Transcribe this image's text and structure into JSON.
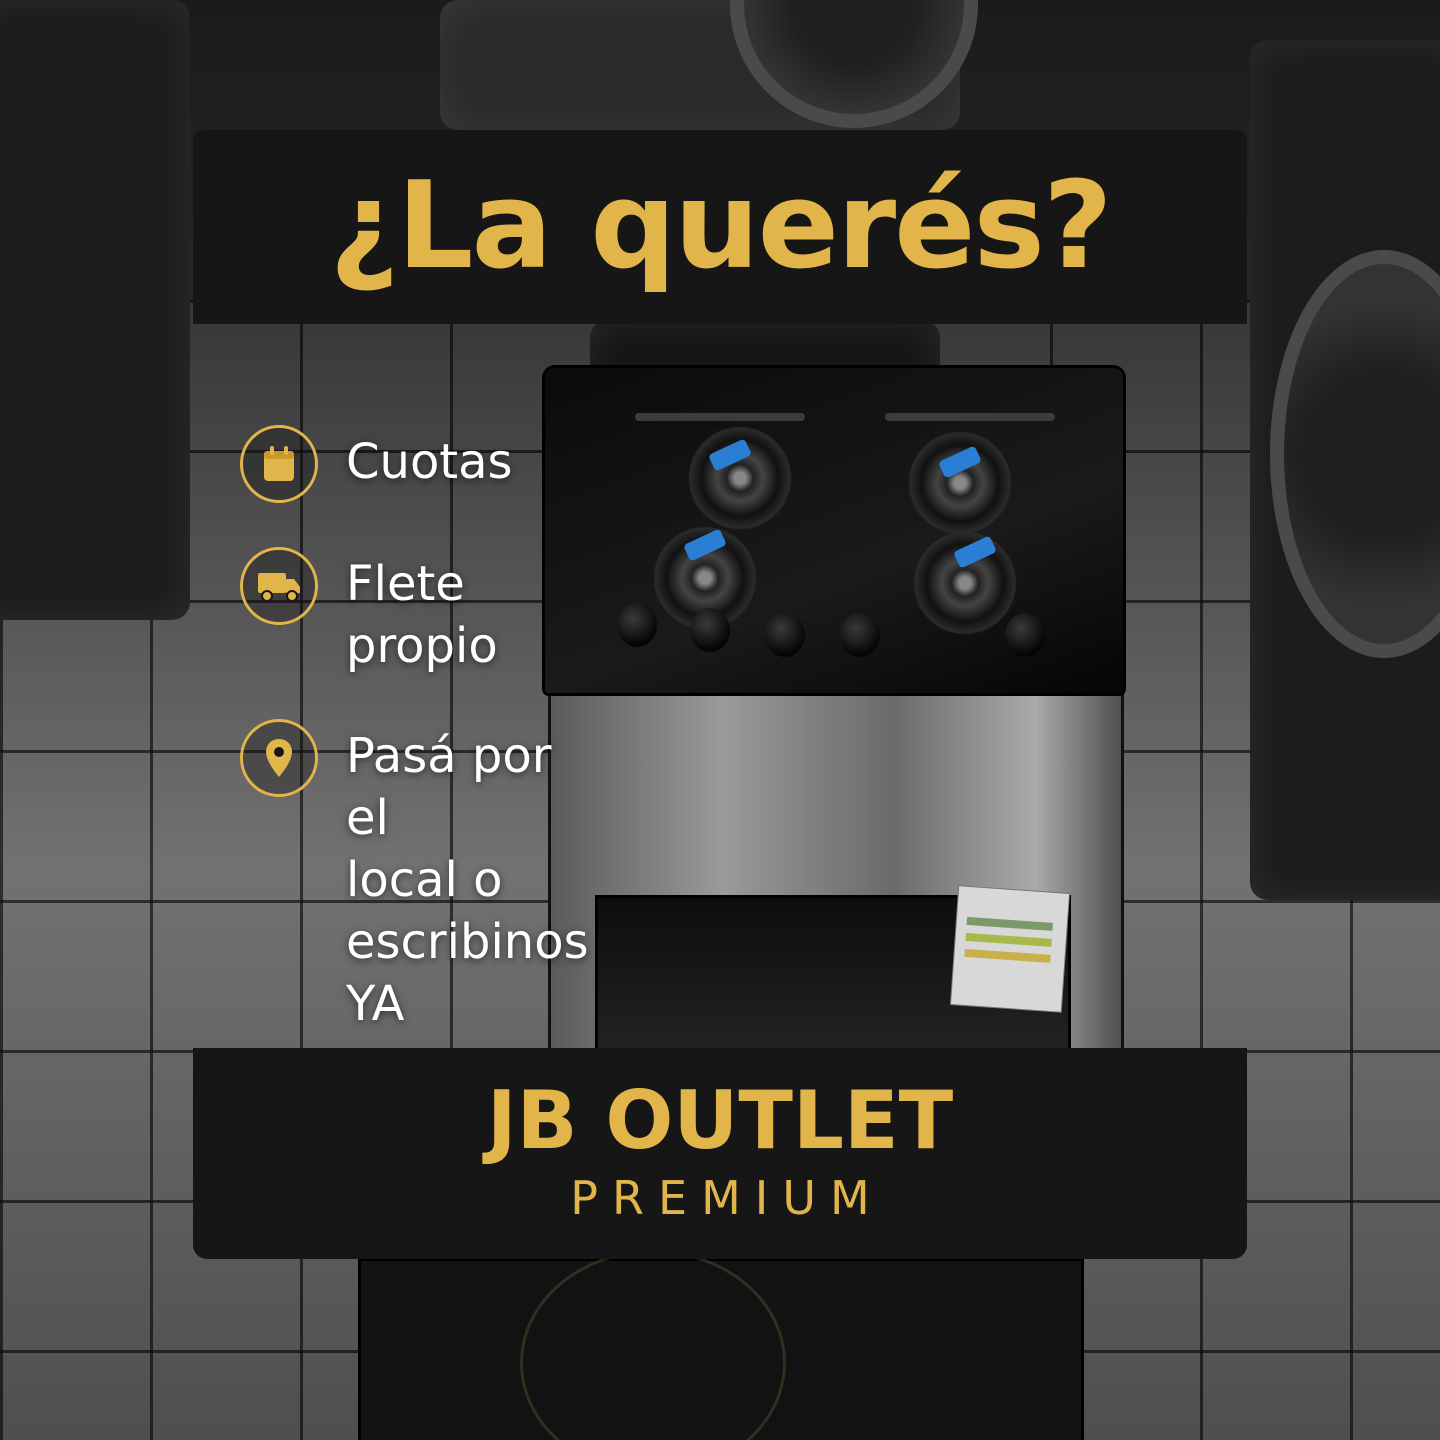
{
  "headline": "¿La querés?",
  "features": [
    {
      "icon": "calendar-icon",
      "lines": [
        "Cuotas"
      ]
    },
    {
      "icon": "delivery-truck-icon",
      "lines": [
        "Flete",
        "propio"
      ]
    },
    {
      "icon": "location-pin-icon",
      "lines": [
        "Pasá por el",
        "local o",
        "escribinos YA"
      ]
    }
  ],
  "brand": {
    "name": "JB OUTLET",
    "tagline": "PREMIUM"
  },
  "colors": {
    "accent": "#e2b54a",
    "panel": "#161616",
    "text": "#ffffff"
  }
}
